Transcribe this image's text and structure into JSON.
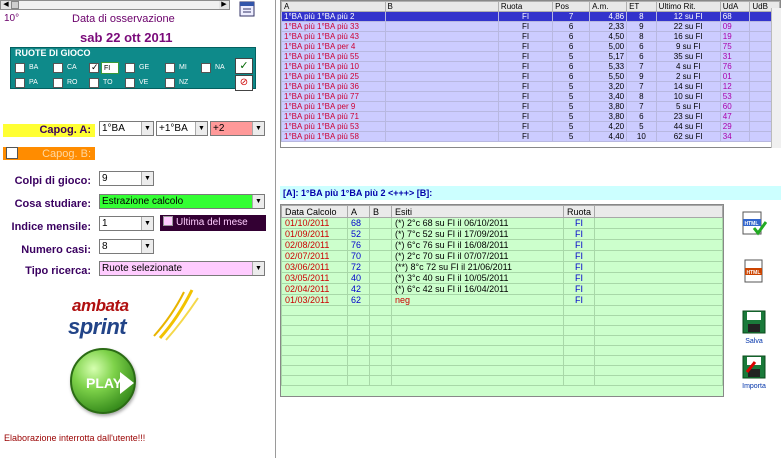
{
  "header": {
    "counter": "10°",
    "obs_label": "Data di osservazione",
    "obs_date": "sab 22 ott 2011"
  },
  "wheels": {
    "title": "RUOTE DI GIOCO",
    "items": [
      {
        "label": "BA",
        "checked": false
      },
      {
        "label": "CA",
        "checked": false
      },
      {
        "label": "FI",
        "checked": true
      },
      {
        "label": "GE",
        "checked": false
      },
      {
        "label": "MI",
        "checked": false
      },
      {
        "label": "NA",
        "checked": false
      },
      {
        "label": "PA",
        "checked": false
      },
      {
        "label": "RO",
        "checked": false
      },
      {
        "label": "TO",
        "checked": false
      },
      {
        "label": "VE",
        "checked": false
      },
      {
        "label": "NZ",
        "checked": false
      }
    ],
    "btn_check": "✓",
    "btn_cancel": "⊘"
  },
  "form": {
    "capog_a_label": "Capog. A:",
    "capog_a_1": "1°BA",
    "capog_a_2": "+1°BA",
    "capog_a_3": "+2",
    "capog_b_label": "Capog. B:",
    "colpi_label": "Colpi di gioco:",
    "colpi_value": "9",
    "studiare_label": "Cosa studiare:",
    "studiare_value": "Estrazione calcolo",
    "indice_label": "Indice mensile:",
    "indice_value": "1",
    "ultima_label": "Ultima del mese",
    "casi_label": "Numero casi:",
    "casi_value": "8",
    "ricerca_label": "Tipo ricerca:",
    "ricerca_value": "Ruote selezionate"
  },
  "logo": {
    "line1": "ambata",
    "line2": "sprint"
  },
  "play_label": "PLAY",
  "status": "Elaborazione interrotta dall'utente!!!",
  "top_grid": {
    "headers": [
      "A",
      "B",
      "Ruota",
      "Pos",
      "A.m.",
      "ET",
      "Ultimo Rit.",
      "UdA",
      "UdB"
    ],
    "rows": [
      {
        "a": "1°BA più  1°BA  più 2",
        "b": "",
        "ruota": "FI",
        "pos": "7",
        "am": "4,86",
        "et": "8",
        "rit": "12 su FI",
        "uda": "68",
        "udb": ""
      },
      {
        "a": "1°BA più  1°BA  più 33",
        "b": "",
        "ruota": "FI",
        "pos": "6",
        "am": "2,33",
        "et": "9",
        "rit": "22 su FI",
        "uda": "09",
        "udb": ""
      },
      {
        "a": "1°BA più  1°BA  più 43",
        "b": "",
        "ruota": "FI",
        "pos": "6",
        "am": "4,50",
        "et": "8",
        "rit": "16 su FI",
        "uda": "19",
        "udb": ""
      },
      {
        "a": "1°BA più  1°BA  per 4",
        "b": "",
        "ruota": "FI",
        "pos": "6",
        "am": "5,00",
        "et": "6",
        "rit": "9 su FI",
        "uda": "75",
        "udb": ""
      },
      {
        "a": "1°BA più  1°BA  più 55",
        "b": "",
        "ruota": "FI",
        "pos": "5",
        "am": "5,17",
        "et": "6",
        "rit": "35 su FI",
        "uda": "31",
        "udb": ""
      },
      {
        "a": "1°BA più  1°BA  più 10",
        "b": "",
        "ruota": "FI",
        "pos": "6",
        "am": "5,33",
        "et": "7",
        "rit": "4 su FI",
        "uda": "76",
        "udb": ""
      },
      {
        "a": "1°BA più  1°BA  più 25",
        "b": "",
        "ruota": "FI",
        "pos": "6",
        "am": "5,50",
        "et": "9",
        "rit": "2 su FI",
        "uda": "01",
        "udb": ""
      },
      {
        "a": "1°BA più  1°BA  più 36",
        "b": "",
        "ruota": "FI",
        "pos": "5",
        "am": "3,20",
        "et": "7",
        "rit": "14 su FI",
        "uda": "12",
        "udb": ""
      },
      {
        "a": "1°BA più  1°BA  più 77",
        "b": "",
        "ruota": "FI",
        "pos": "5",
        "am": "3,40",
        "et": "8",
        "rit": "10 su FI",
        "uda": "53",
        "udb": ""
      },
      {
        "a": "1°BA più  1°BA  per 9",
        "b": "",
        "ruota": "FI",
        "pos": "5",
        "am": "3,80",
        "et": "7",
        "rit": "5 su FI",
        "uda": "60",
        "udb": ""
      },
      {
        "a": "1°BA più  1°BA  più 71",
        "b": "",
        "ruota": "FI",
        "pos": "5",
        "am": "3,80",
        "et": "6",
        "rit": "23 su FI",
        "uda": "47",
        "udb": ""
      },
      {
        "a": "1°BA più  1°BA  più 53",
        "b": "",
        "ruota": "FI",
        "pos": "5",
        "am": "4,20",
        "et": "5",
        "rit": "44 su FI",
        "uda": "29",
        "udb": ""
      },
      {
        "a": "1°BA più  1°BA  più 58",
        "b": "",
        "ruota": "FI",
        "pos": "5",
        "am": "4,40",
        "et": "10",
        "rit": "62 su FI",
        "uda": "34",
        "udb": ""
      }
    ]
  },
  "info_bar": "[A]: 1°BA più  1°BA  più 2 <+++> [B]:",
  "bottom_grid": {
    "headers": [
      "Data Calcolo",
      "A",
      "B",
      "Esiti",
      "Ruota"
    ],
    "rows": [
      {
        "date": "01/10/2011",
        "a": "68",
        "b": "",
        "esito": "(*) 2°c 68 su FI il 06/10/2011",
        "ruota": "FI"
      },
      {
        "date": "01/09/2011",
        "a": "52",
        "b": "",
        "esito": "(*) 7°c 52 su FI il 17/09/2011",
        "ruota": "FI"
      },
      {
        "date": "02/08/2011",
        "a": "76",
        "b": "",
        "esito": "(*) 6°c 76 su FI il 16/08/2011",
        "ruota": "FI"
      },
      {
        "date": "02/07/2011",
        "a": "70",
        "b": "",
        "esito": "(*) 2°c 70 su FI il 07/07/2011",
        "ruota": "FI"
      },
      {
        "date": "03/06/2011",
        "a": "72",
        "b": "",
        "esito": "(**) 8°c 72 su FI il 21/06/2011",
        "ruota": "FI"
      },
      {
        "date": "03/05/2011",
        "a": "40",
        "b": "",
        "esito": "(*) 3°c 40 su FI il 10/05/2011",
        "ruota": "FI"
      },
      {
        "date": "02/04/2011",
        "a": "42",
        "b": "",
        "esito": "(*) 6°c 42 su FI il 16/04/2011",
        "ruota": "FI"
      },
      {
        "date": "01/03/2011",
        "a": "62",
        "b": "",
        "esito": "neg",
        "ruota": "FI"
      }
    ]
  },
  "side_buttons": {
    "html1": "HTML",
    "html2": "HTML",
    "salva": "Salva",
    "importa": "Importa"
  }
}
